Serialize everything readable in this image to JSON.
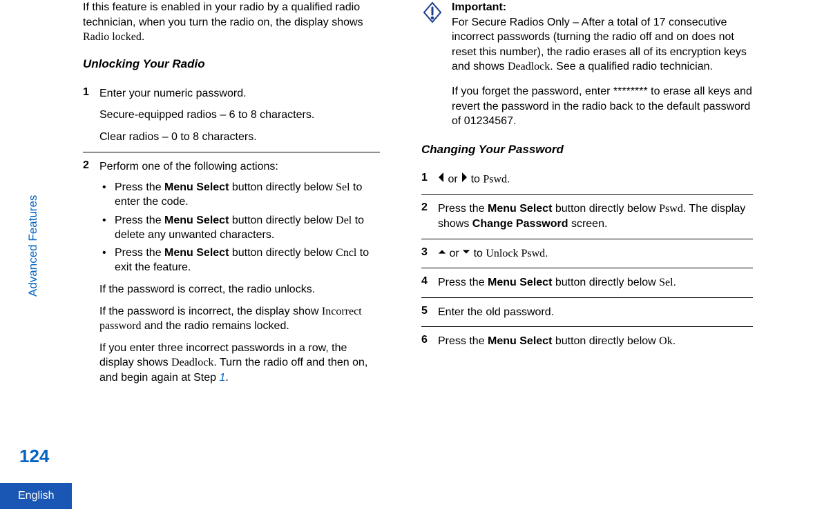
{
  "sidebar": {
    "section_label": "Advanced Features",
    "page_number": "124",
    "language": "English"
  },
  "left": {
    "intro_text_1": "If this feature is enabled in your radio by a qualified radio technician, when you turn the radio on, the display shows ",
    "intro_display": "Radio locked",
    "intro_text_2": ".",
    "heading_unlock": "Unlocking Your Radio",
    "step1": {
      "num": "1",
      "line1": "Enter your numeric password.",
      "line2": "Secure-equipped radios – 6 to 8 characters.",
      "line3": "Clear radios – 0 to 8 characters."
    },
    "step2": {
      "num": "2",
      "line1": "Perform one of the following actions:",
      "b1a": "Press the ",
      "b1b": "Menu Select",
      "b1c": " button directly below ",
      "b1d": "Sel",
      "b1e": " to enter the code.",
      "b2a": "Press the ",
      "b2b": "Menu Select",
      "b2c": " button directly below ",
      "b2d": "Del",
      "b2e": " to delete any unwanted characters.",
      "b3a": "Press the ",
      "b3b": "Menu Select",
      "b3c": " button directly below ",
      "b3d": "Cncl",
      "b3e": " to exit the feature.",
      "p1": "If the password is correct, the radio unlocks.",
      "p2a": "If the password is incorrect, the display show ",
      "p2b": "Incorrect password",
      "p2c": " and the radio remains locked.",
      "p3a": "If you enter three incorrect passwords in a row, the display shows ",
      "p3b": "Deadlock",
      "p3c": ". Turn the radio off and then on, and begin again at Step ",
      "p3link": "1",
      "p3d": "."
    }
  },
  "right": {
    "important": {
      "title": "Important:",
      "p1a": "For Secure Radios Only – After a total of 17 consecutive incorrect passwords (turning the radio off and on does not reset this number), the radio erases all of its encryption keys and shows ",
      "p1b": "Deadlock",
      "p1c": ". See a qualified radio technician.",
      "p2": "If you forget the password, enter ******** to erase all keys and revert the password in the radio back to the default password of 01234567."
    },
    "heading_change": "Changing Your Password",
    "step1": {
      "num": "1",
      "mid": " or ",
      "tail": " to ",
      "disp": "Pswd",
      "end": "."
    },
    "step2": {
      "num": "2",
      "a": "Press the ",
      "b": "Menu Select",
      "c": " button directly below ",
      "d": "Pswd",
      "e": ". The display shows ",
      "f": "Change Password",
      "g": " screen."
    },
    "step3": {
      "num": "3",
      "mid": " or ",
      "tail": " to ",
      "disp": "Unlock Pswd",
      "end": "."
    },
    "step4": {
      "num": "4",
      "a": "Press the ",
      "b": "Menu Select",
      "c": " button directly below ",
      "d": "Sel",
      "e": "."
    },
    "step5": {
      "num": "5",
      "text": "Enter the old password."
    },
    "step6": {
      "num": "6",
      "a": "Press the ",
      "b": "Menu Select",
      "c": " button directly below ",
      "d": "Ok",
      "e": "."
    }
  }
}
